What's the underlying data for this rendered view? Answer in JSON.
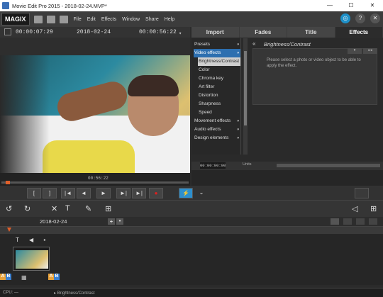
{
  "window": {
    "title": "Movie Edit Pro 2015 - 2018-02-24.MVP*",
    "controls": [
      "—",
      "☐",
      "✕"
    ]
  },
  "menubar": {
    "logo": "MAGIX",
    "menus": [
      "File",
      "Edit",
      "Effects",
      "Window",
      "Share",
      "Help"
    ],
    "right_buttons": [
      "◎",
      "?",
      "✕"
    ]
  },
  "monitor": {
    "timecode_left": "00:00:07:29",
    "date": "2018-02-24",
    "timecode_right": "00:00:56:22",
    "scrub_time": "00:56:22"
  },
  "tabs": [
    {
      "label": "Import",
      "active": false
    },
    {
      "label": "Fades",
      "active": false
    },
    {
      "label": "Title",
      "active": false
    },
    {
      "label": "Effects",
      "active": true
    }
  ],
  "effects_list": {
    "items": [
      {
        "label": "Presets",
        "type": "cat"
      },
      {
        "label": "Video effects",
        "type": "sel"
      },
      {
        "label": "Brightness/Contrast",
        "type": "subsel"
      },
      {
        "label": "Color",
        "type": "sub"
      },
      {
        "label": "Chroma key",
        "type": "sub"
      },
      {
        "label": "Art filter",
        "type": "sub"
      },
      {
        "label": "Distortion",
        "type": "sub"
      },
      {
        "label": "Sharpness",
        "type": "sub"
      },
      {
        "label": "Speed",
        "type": "sub"
      },
      {
        "label": "Movement effects",
        "type": "cat"
      },
      {
        "label": "Audio effects",
        "type": "cat"
      },
      {
        "label": "Design elements",
        "type": "cat"
      }
    ]
  },
  "properties": {
    "title": "Brightness/Contrast",
    "message": "Please select a photo or video object to be able to apply the effect."
  },
  "mini_timeline": {
    "timecode": "00:00:00:00",
    "unit": "Units"
  },
  "transport": {
    "buttons": [
      "[",
      "]",
      "|◄",
      "◄",
      "►",
      "►|",
      "►|",
      "●"
    ]
  },
  "toolbar": {
    "tools": [
      "↺",
      "↻",
      "✕",
      "T",
      "✎",
      "⊞"
    ]
  },
  "timeline": {
    "date": "2018-02-24",
    "add_label": "+",
    "dropdown_label": "▾",
    "track_icons": "T ◀ ▪",
    "ab_left": [
      "A",
      "B"
    ],
    "ab_right": [
      "A",
      "B"
    ]
  },
  "status": {
    "cpu": "CPU: —",
    "current": "▸ Brightness/Contrast"
  }
}
